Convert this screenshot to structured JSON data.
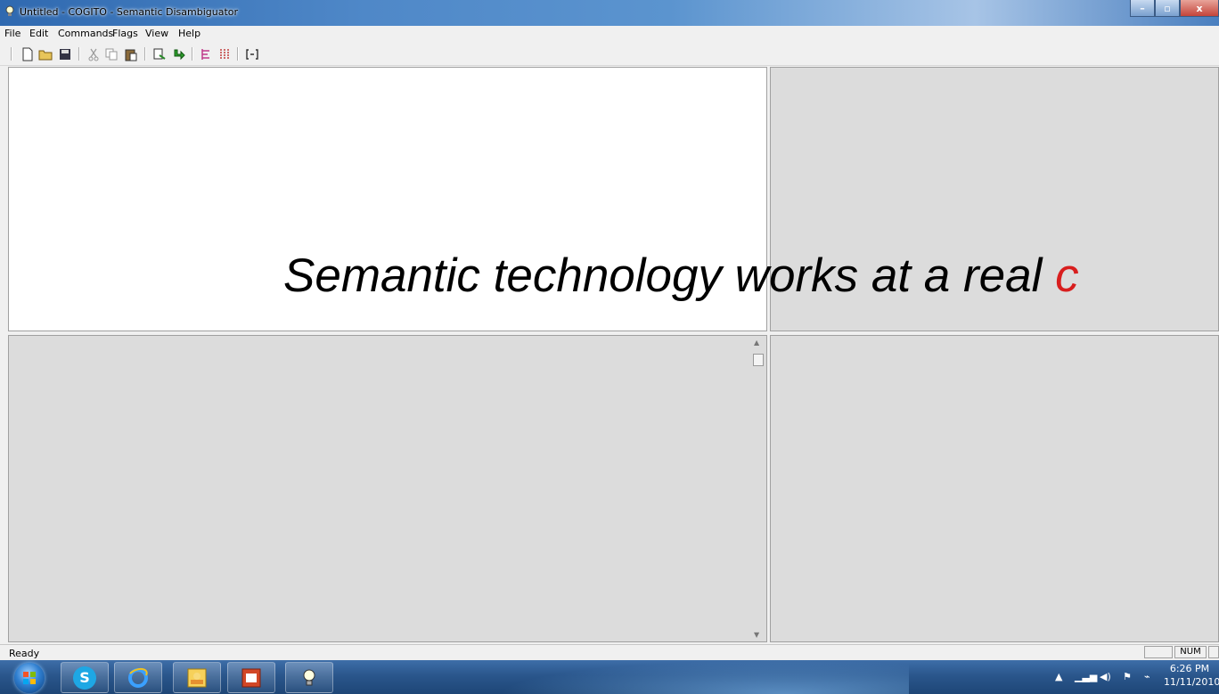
{
  "window": {
    "title": "Untitled - COGITO - Semantic Disambiguator",
    "controls": {
      "minimize": "–",
      "maximize": "▫",
      "close": "x"
    }
  },
  "menubar": {
    "items": [
      "File",
      "Edit",
      "Commands",
      "Flags",
      "View",
      "Help"
    ]
  },
  "toolbar": {
    "buttons": [
      "new-document-icon",
      "open-folder-icon",
      "save-icon",
      "cut-icon",
      "copy-icon",
      "paste-icon",
      "analyze-icon",
      "next-arrow-icon",
      "tree-view-icon",
      "columns-icon",
      "bracket-icon"
    ]
  },
  "overlay_caption": {
    "text_black": "Semantic technology works at a real ",
    "text_red": "c"
  },
  "statusbar": {
    "status": "Ready",
    "num_indicator": "NUM"
  },
  "taskbar": {
    "apps": [
      "start-orb",
      "skype",
      "internet-explorer",
      "photo-viewer",
      "powerpoint",
      "cogito"
    ],
    "skype_glyph": "S",
    "clock": {
      "time": "6:26 PM",
      "date": "11/11/2010"
    }
  }
}
